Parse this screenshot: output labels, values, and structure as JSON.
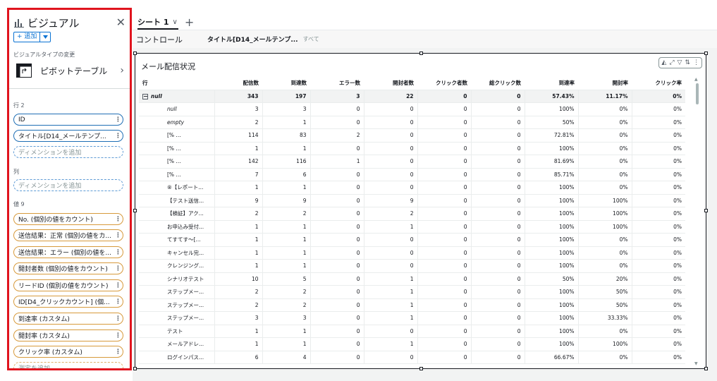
{
  "left_panel": {
    "title": "ビジュアル",
    "add_label": "+ 追加",
    "visual_type_caption": "ビジュアルタイプの変更",
    "visual_type": "ピボットテーブル",
    "rows_header": "行 2",
    "rows": [
      "ID",
      "タイトル[D14_メールテンプ..."
    ],
    "add_dimension": "ディメンションを追加",
    "columns_header": "列",
    "values_header": "値 9",
    "values": [
      "No. (個別の値をカウント)",
      "送信結果：正常 (個別の値をカ...",
      "送信結果：エラー (個別の値を...",
      "開封者数 (個別の値をカウント)",
      "リードID (個別の値をカウント)",
      "ID[D4_クリックカウント] (個...",
      "到達率 (カスタム)",
      "開封率 (カスタム)",
      "クリック率 (カスタム)"
    ],
    "add_measure": "測定を追加"
  },
  "sheet": {
    "tab_label": "シート 1"
  },
  "controls": {
    "label": "コントロール",
    "filter": "タイトル[D14_メールテンプ...",
    "filter_value": "すべて"
  },
  "visual": {
    "title": "メール配信状況",
    "columns": [
      "行",
      "配信数",
      "到達数",
      "エラー数",
      "開封者数",
      "クリック者数",
      "総クリック数",
      "到達率",
      "開封率",
      "クリック率"
    ],
    "total_row": [
      "null",
      "343",
      "197",
      "3",
      "22",
      "0",
      "0",
      "57.43%",
      "11.17%",
      "0%"
    ],
    "rows": [
      [
        "null",
        "3",
        "3",
        "0",
        "0",
        "0",
        "0",
        "100%",
        "0%",
        "0%"
      ],
      [
        "empty",
        "2",
        "1",
        "0",
        "0",
        "0",
        "0",
        "50%",
        "0%",
        "0%"
      ],
      [
        "[% ...",
        "114",
        "83",
        "2",
        "0",
        "0",
        "0",
        "72.81%",
        "0%",
        "0%"
      ],
      [
        "[% ...",
        "1",
        "1",
        "0",
        "0",
        "0",
        "0",
        "100%",
        "0%",
        "0%"
      ],
      [
        "[% ...",
        "142",
        "116",
        "1",
        "0",
        "0",
        "0",
        "81.69%",
        "0%",
        "0%"
      ],
      [
        "[% ...",
        "7",
        "6",
        "0",
        "0",
        "0",
        "0",
        "85.71%",
        "0%",
        "0%"
      ],
      [
        "⑧【レポート...",
        "1",
        "1",
        "0",
        "0",
        "0",
        "0",
        "100%",
        "0%",
        "0%"
      ],
      [
        "【テスト送信...",
        "9",
        "9",
        "0",
        "9",
        "0",
        "0",
        "100%",
        "100%",
        "0%"
      ],
      [
        "【検証】アク...",
        "2",
        "2",
        "0",
        "2",
        "0",
        "0",
        "100%",
        "100%",
        "0%"
      ],
      [
        "お申込み受付...",
        "1",
        "1",
        "0",
        "1",
        "0",
        "0",
        "100%",
        "100%",
        "0%"
      ],
      [
        "てすてす～[...",
        "1",
        "1",
        "0",
        "0",
        "0",
        "0",
        "100%",
        "0%",
        "0%"
      ],
      [
        "キャンセル完...",
        "1",
        "1",
        "0",
        "0",
        "0",
        "0",
        "100%",
        "0%",
        "0%"
      ],
      [
        "クレンジング...",
        "1",
        "1",
        "0",
        "0",
        "0",
        "0",
        "100%",
        "0%",
        "0%"
      ],
      [
        "シナリオテスト",
        "10",
        "5",
        "0",
        "1",
        "0",
        "0",
        "50%",
        "20%",
        "0%"
      ],
      [
        "ステップメー...",
        "2",
        "2",
        "0",
        "1",
        "0",
        "0",
        "100%",
        "50%",
        "0%"
      ],
      [
        "ステップメー...",
        "2",
        "2",
        "0",
        "1",
        "0",
        "0",
        "100%",
        "50%",
        "0%"
      ],
      [
        "ステップメー...",
        "3",
        "3",
        "0",
        "1",
        "0",
        "0",
        "100%",
        "33.33%",
        "0%"
      ],
      [
        "テスト",
        "1",
        "1",
        "0",
        "0",
        "0",
        "0",
        "100%",
        "0%",
        "0%"
      ],
      [
        "メールアドレ...",
        "1",
        "1",
        "0",
        "1",
        "0",
        "0",
        "100%",
        "100%",
        "0%"
      ],
      [
        "ログインパス...",
        "6",
        "4",
        "0",
        "0",
        "0",
        "0",
        "66.67%",
        "0%",
        "0%"
      ]
    ]
  }
}
